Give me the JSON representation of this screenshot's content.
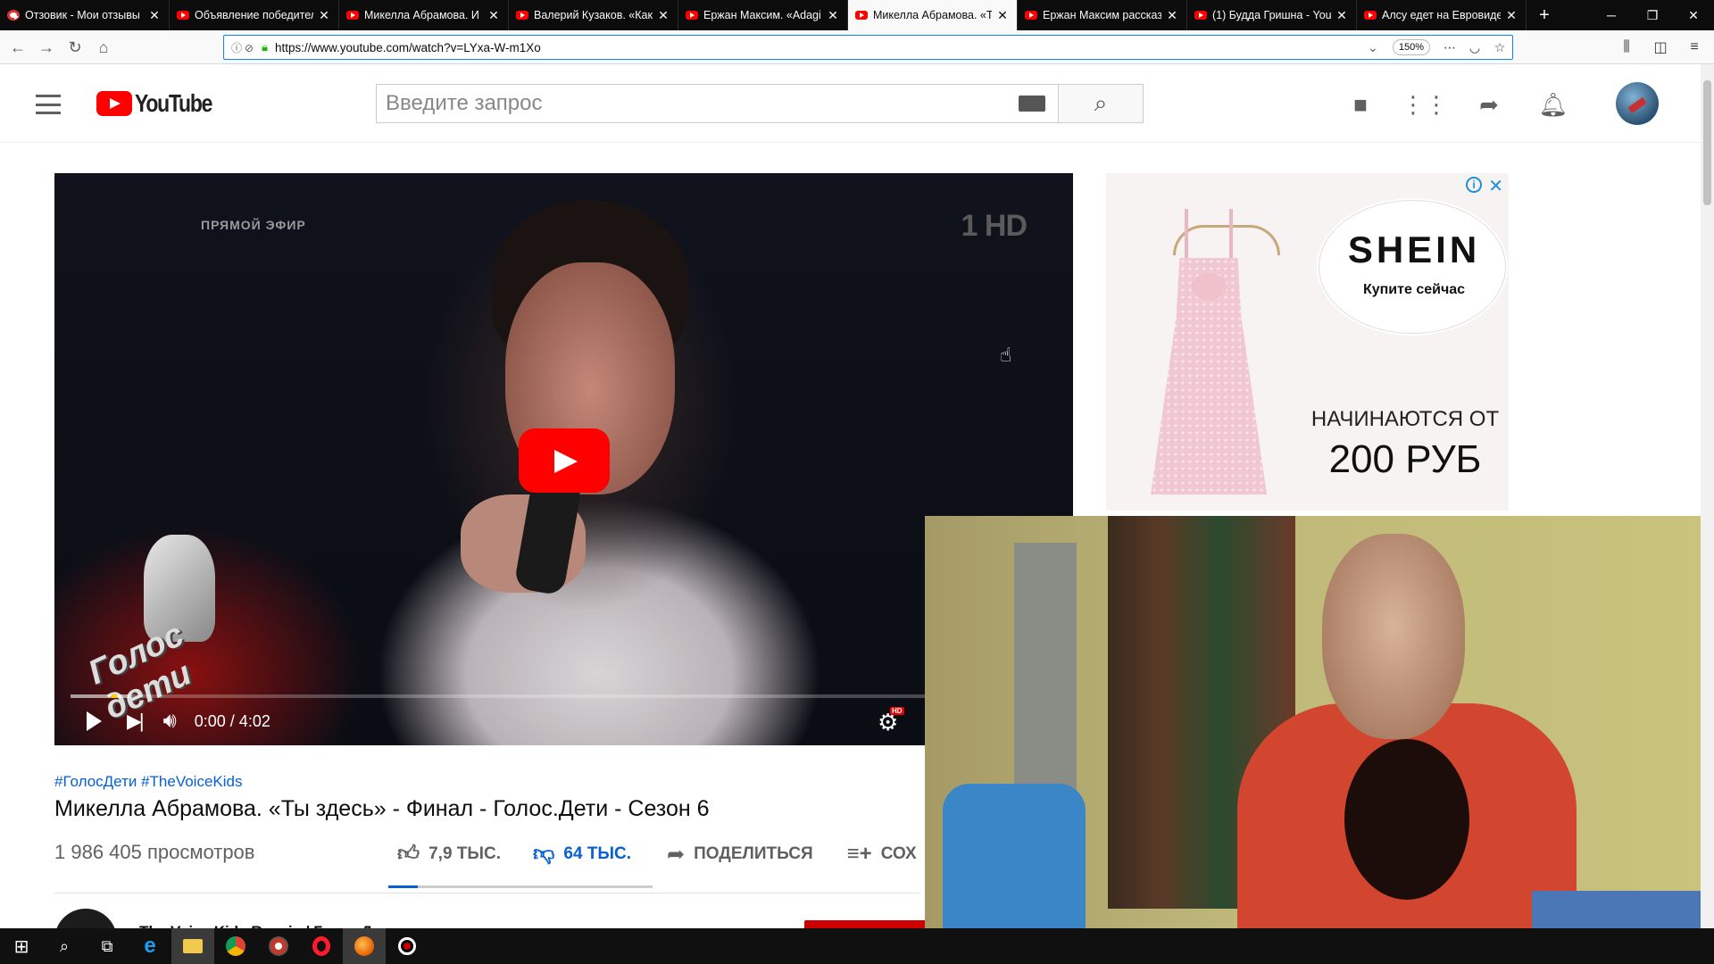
{
  "browser": {
    "tabs": [
      {
        "label": "Отзовик - Мои отзывы",
        "active": false,
        "favicon": "otzovik-icon"
      },
      {
        "label": "Объявление победителя",
        "active": false,
        "favicon": "youtube-icon"
      },
      {
        "label": "Микелла Абрамова. И",
        "active": false,
        "favicon": "youtube-icon"
      },
      {
        "label": "Валерий Кузаков. «Как",
        "active": false,
        "favicon": "youtube-icon"
      },
      {
        "label": "Ержан Максим. «Adagi",
        "active": false,
        "favicon": "youtube-icon"
      },
      {
        "label": "Микелла Абрамова. «Т",
        "active": true,
        "favicon": "youtube-icon"
      },
      {
        "label": "Ержан Максим рассказ",
        "active": false,
        "favicon": "youtube-icon"
      },
      {
        "label": "(1) Будда Гришна - You",
        "active": false,
        "favicon": "youtube-icon"
      },
      {
        "label": "Алсу едет на Евровиде",
        "active": false,
        "favicon": "youtube-icon"
      }
    ],
    "url": "https://www.youtube.com/watch?v=LYxa-W-m1Xo",
    "zoom": "150%"
  },
  "youtube": {
    "logo_text": "YouTube",
    "search_placeholder": "Введите запрос"
  },
  "video": {
    "overlay_live": "ПРЯМОЙ ЭФИР",
    "channel_logo": "HD",
    "show_logo": "Голос дети",
    "time": "0:00 / 4:02",
    "progress": 0.0,
    "hashtags": "#ГолосДети #TheVoiceKids",
    "title": "Микелла Абрамова. «Ты здесь» - Финал - Голос.Дети - Сезон 6",
    "views": "1 986 405 просмотров",
    "likes": "7,9 ТЫС.",
    "dislikes": "64 ТЫС.",
    "share": "ПОДЕЛИТЬСЯ",
    "save": "СОХ",
    "channel_name": "The Voice Kids Russia / Голос.Дети"
  },
  "ad": {
    "brand": "SHEIN",
    "cta": "Купите сейчас",
    "price_prefix": "НАЧИНАЮТСЯ ОТ",
    "price": "200 РУБ"
  },
  "colors": {
    "youtube_red": "#ff0000",
    "link_blue": "#065fd4",
    "url_focus": "#0a84ff"
  }
}
